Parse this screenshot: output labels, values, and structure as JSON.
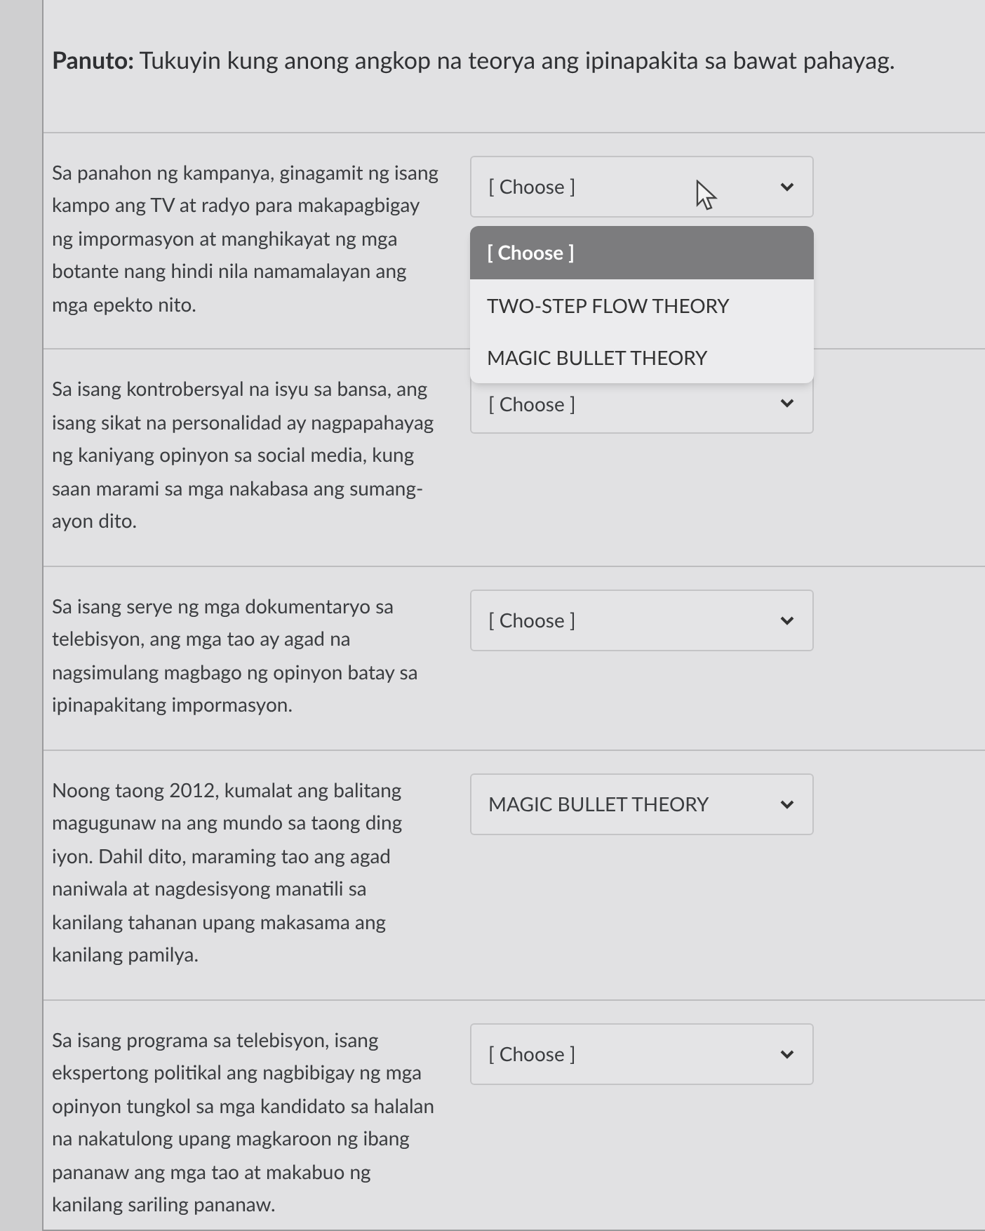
{
  "instruction": "**Panuto:** Tukuyin kung anong angkop na teorya ang ipinapakita sa bawat pahayag.",
  "questions": [
    {
      "text": "Sa panahon ng kampanya, ginagamit ng isang kampo ang TV at radyo para makapagbigay ng impormasyon at manghikayat ng mga botante nang hindi nila namamalayan ang mga epekto nito.",
      "value": "[ Choose ]",
      "expanded": true,
      "options": [
        {
          "label": "[ Choose ]",
          "selected": true
        },
        {
          "label": "TWO-STEP FLOW THEORY",
          "selected": false
        },
        {
          "label": "MAGIC BULLET THEORY",
          "selected": false
        }
      ]
    },
    {
      "text": "Sa isang kontrobersyal na isyu sa bansa, ang isang sikat na personalidad ay nagpapahayag ng kaniyang opinyon sa social media, kung saan marami sa mga nakabasa ang sumang-ayon dito.",
      "value": "[ Choose ]",
      "expanded": false
    },
    {
      "text": "Sa isang serye ng mga dokumentaryo sa telebisyon, ang mga tao ay agad na nagsimulang magbago ng opinyon batay sa ipinapakitang impormasyon.",
      "value": "[ Choose ]",
      "expanded": false
    },
    {
      "text": "Noong taong 2012, kumalat ang balitang magugunaw na ang mundo sa taong ding iyon. Dahil dito, maraming tao ang agad naniwala at nagdesisyong manatili sa kanilang tahanan upang makasama ang kanilang pamilya.",
      "value": "MAGIC BULLET THEORY",
      "expanded": false
    },
    {
      "text": "Sa isang programa sa telebisyon, isang ekspertong politikal ang nagbibigay ng mga opinyon tungkol sa mga kandidato sa halalan na nakatulong upang magkaroon ng ibang pananaw ang mga tao at makabuo ng kanilang sariling pananaw.",
      "value": "[ Choose ]",
      "expanded": false
    }
  ]
}
